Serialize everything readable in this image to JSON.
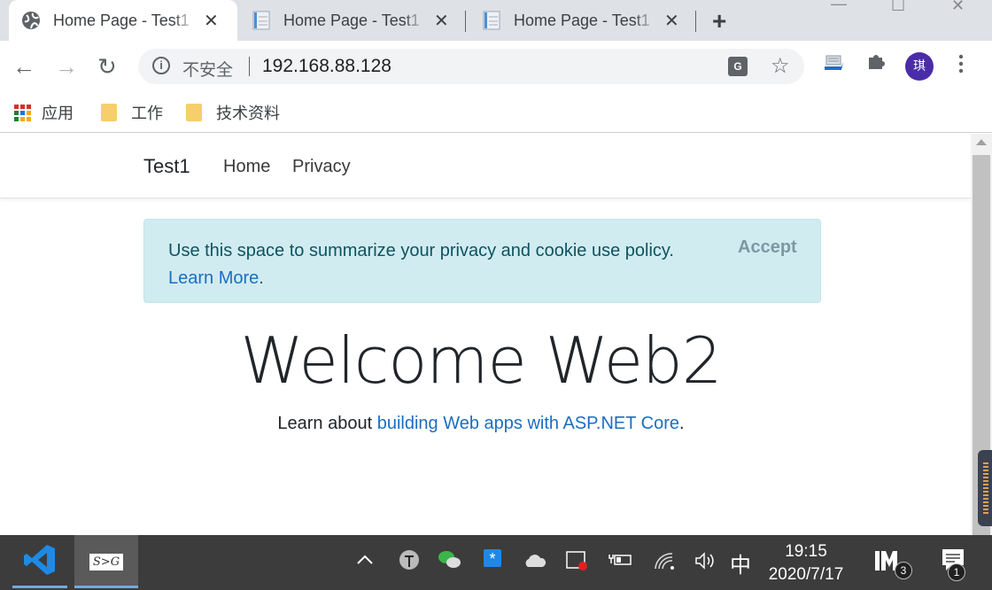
{
  "browser": {
    "tabs": [
      {
        "title": "Home Page - Test1",
        "icon": "globe-icon",
        "active": true
      },
      {
        "title": "Home Page - Test1",
        "icon": "page-favicon-icon",
        "active": false
      },
      {
        "title": "Home Page - Test1",
        "icon": "page-favicon-icon",
        "active": false
      }
    ],
    "new_tab_label": "+",
    "close_glyph": "✕",
    "window_controls": {
      "minimize": "—",
      "maximize": "☐",
      "close": "✕"
    },
    "toolbar": {
      "back": "←",
      "forward": "→",
      "reload": "↻",
      "security_label": "不安全",
      "url": "192.168.88.128",
      "star": "☆",
      "puzzle": "✚",
      "avatar_text": "琪",
      "menu": "⋮",
      "translate_text": "G"
    },
    "bookmarks": [
      {
        "label": "应用",
        "icon": "apps-grid-icon"
      },
      {
        "label": "工作",
        "icon": "folder-icon"
      },
      {
        "label": "技术资料",
        "icon": "folder-icon"
      }
    ]
  },
  "page": {
    "brand": "Test1",
    "nav": [
      {
        "label": "Home"
      },
      {
        "label": "Privacy"
      }
    ],
    "cookie_alert": {
      "text": "Use this space to summarize your privacy and cookie use policy. ",
      "link_text": "Learn More",
      "suffix": ".",
      "accept_label": "Accept"
    },
    "hero": {
      "title": "Welcome Web2",
      "sub_prefix": "Learn about ",
      "sub_link": "building Web apps with ASP.NET Core",
      "sub_suffix": "."
    }
  },
  "taskbar": {
    "apps": [
      {
        "name": "Visual Studio Code",
        "icon": "vscode-icon"
      },
      {
        "name": "S>G",
        "label": "S>G",
        "icon": "sg-app-icon"
      }
    ],
    "tray": {
      "chevron": "^",
      "ime": "中",
      "time": "19:15",
      "date": "2020/7/17",
      "im_badge": "3",
      "notification_badge": "1"
    }
  }
}
